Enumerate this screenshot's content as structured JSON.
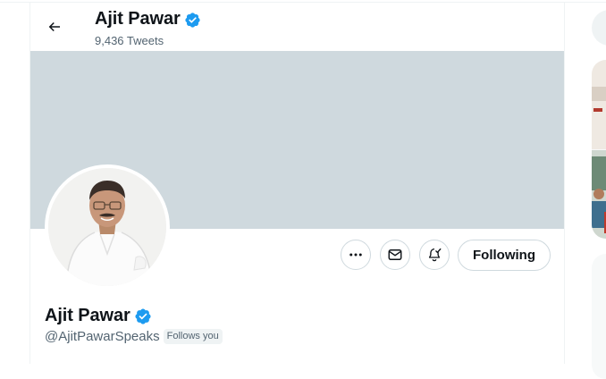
{
  "header": {
    "name": "Ajit Pawar",
    "tweet_count": "9,436 Tweets",
    "verified": true
  },
  "profile": {
    "name": "Ajit Pawar",
    "handle": "@AjitPawarSpeaks",
    "follows_you_label": "Follows you",
    "verified": true
  },
  "actions": {
    "more_icon": "more-horizontal-icon",
    "message_icon": "envelope-icon",
    "notify_icon": "bell-check-icon",
    "following_label": "Following"
  },
  "colors": {
    "verified_blue": "#1d9bf0",
    "banner": "#cfd9de",
    "text_primary": "#0f1419",
    "text_secondary": "#536471"
  }
}
